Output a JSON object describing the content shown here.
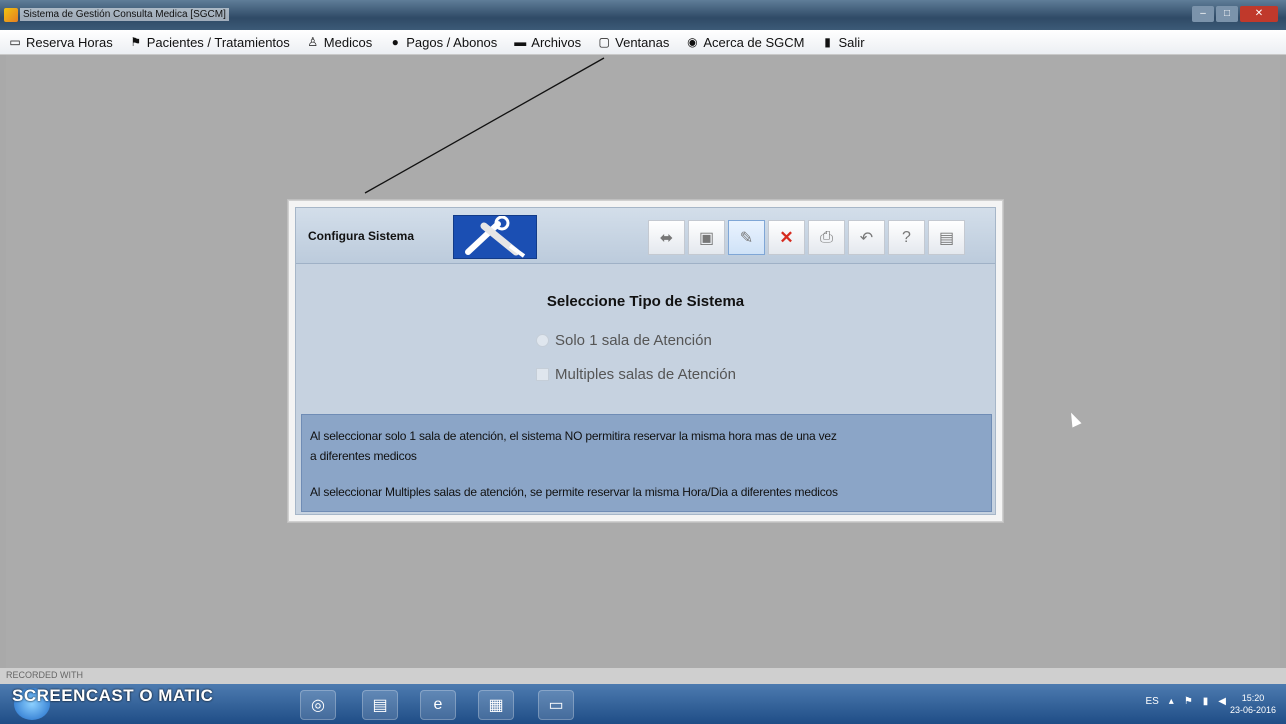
{
  "window": {
    "title": "Sistema de Gestión Consulta Medica [SGCM]"
  },
  "menu": [
    {
      "label": "Reserva Horas",
      "icon": "calendar-icon",
      "glyph": "▭"
    },
    {
      "label": "Pacientes / Tratamientos",
      "icon": "patients-icon",
      "glyph": "⚑"
    },
    {
      "label": "Medicos",
      "icon": "doctor-icon",
      "glyph": "♙"
    },
    {
      "label": "Pagos / Abonos",
      "icon": "payments-icon",
      "glyph": "●"
    },
    {
      "label": "Archivos",
      "icon": "folder-icon",
      "glyph": "▬"
    },
    {
      "label": "Ventanas",
      "icon": "windows-icon",
      "glyph": "▢"
    },
    {
      "label": "Acerca de SGCM",
      "icon": "info-icon",
      "glyph": "◉"
    },
    {
      "label": "Salir",
      "icon": "exit-icon",
      "glyph": "▮"
    }
  ],
  "config": {
    "title": "Configura Sistema",
    "toolbar": [
      {
        "icon": "new-icon",
        "glyph": "⬌"
      },
      {
        "icon": "save-icon",
        "glyph": "▣"
      },
      {
        "icon": "edit-icon",
        "glyph": "✎"
      },
      {
        "icon": "delete-icon",
        "glyph": "✕"
      },
      {
        "icon": "print-icon",
        "glyph": "⎙"
      },
      {
        "icon": "undo-icon",
        "glyph": "↶"
      },
      {
        "icon": "help-icon",
        "glyph": "?"
      },
      {
        "icon": "exit-icon",
        "glyph": "▤"
      }
    ],
    "select_title": "Seleccione Tipo de Sistema",
    "option_single": "Solo 1 sala de Atención",
    "option_multiple": "Multiples salas de Atención",
    "info_line1": "Al seleccionar solo 1 sala de atención, el  sistema NO permitira reservar la misma hora mas de una vez",
    "info_line2": "a diferentes medicos",
    "info_line3": "Al seleccionar Multiples salas de atención, se permite reservar la misma  Hora/Dia  a diferentes medicos"
  },
  "watermark": "RECORDED WITH",
  "taskbar": {
    "brand": "SCREENCAST O MATIC",
    "lang": "ES",
    "time": "15:20",
    "date": "23-06-2016"
  }
}
